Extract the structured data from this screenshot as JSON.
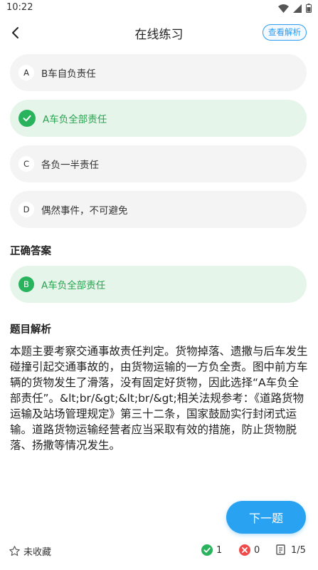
{
  "status_bar": {
    "time": "10:22"
  },
  "header": {
    "title": "在线练习",
    "analysis_button": "查看解析"
  },
  "options": [
    {
      "badge": "A",
      "text": "B车自负责任",
      "state": "normal"
    },
    {
      "badge": "",
      "text": "A车负全部责任",
      "state": "selected-correct"
    },
    {
      "badge": "C",
      "text": "各负一半责任",
      "state": "normal"
    },
    {
      "badge": "D",
      "text": "偶然事件，不可避免",
      "state": "normal"
    }
  ],
  "answer": {
    "title": "正确答案",
    "badge": "B",
    "text": "A车负全部责任"
  },
  "analysis": {
    "title": "题目解析",
    "text": "本题主要考察交通事故责任判定。货物掉落、遗撒与后车发生碰撞引起交通事故的，由货物运输的一方负全责。图中前方车辆的货物发生了滑落，没有固定好货物，因此选择“A车负全部责任”。&lt;br/&gt;&lt;br/&gt;相关法规参考：《道路货物运输及站场管理规定》第三十二条，国家鼓励实行封闭式运输。道路货物运输经营者应当采取有效的措施，防止货物脱落、扬撒等情况发生。"
  },
  "next_button": "下一题",
  "bottom": {
    "favorite_label": "未收藏",
    "correct_count": "1",
    "wrong_count": "0",
    "progress": "1/5"
  },
  "colors": {
    "accent": "#2aa2f2",
    "correct": "#28b35c",
    "wrong": "#ef4b4b",
    "correct_bg": "#e6f5ea"
  }
}
